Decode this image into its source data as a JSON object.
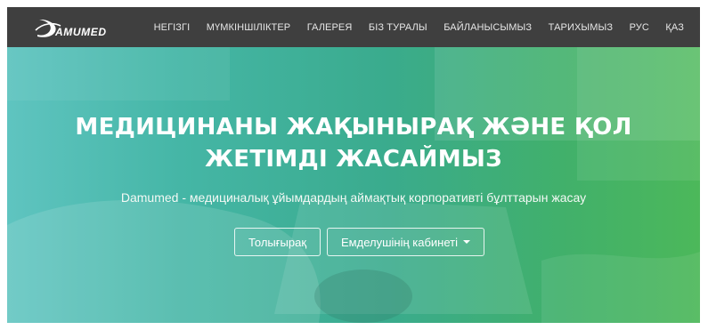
{
  "brand": {
    "logo_text": "AMUMED"
  },
  "nav": {
    "items": [
      {
        "label": "НЕГІЗГІ"
      },
      {
        "label": "МҮМКІНШІЛІКТЕР"
      },
      {
        "label": "ГАЛЕРЕЯ"
      },
      {
        "label": "БІЗ ТУРАЛЫ"
      },
      {
        "label": "БАЙЛАНЫСЫМЫЗ"
      },
      {
        "label": "ТАРИХЫМЫЗ"
      },
      {
        "label": "РУС"
      },
      {
        "label": "ҚАЗ"
      }
    ]
  },
  "hero": {
    "title_line1": "МЕДИЦИНАНЫ ЖАҚЫНЫРАҚ ЖӘНЕ ҚОЛ",
    "title_line2": "ЖЕТІМДІ ЖАСАЙМЫЗ",
    "subtitle": "Damumed - медициналық ұйымдардың аймақтық корпоративті бұлттарын жасау",
    "btn_more": "Толығырақ",
    "btn_cabinet": "Емделушінің кабинеті"
  },
  "colors": {
    "navbar": "#3f3f3f",
    "hero_left": "#5fc4c0",
    "hero_right": "#4cb85a"
  }
}
